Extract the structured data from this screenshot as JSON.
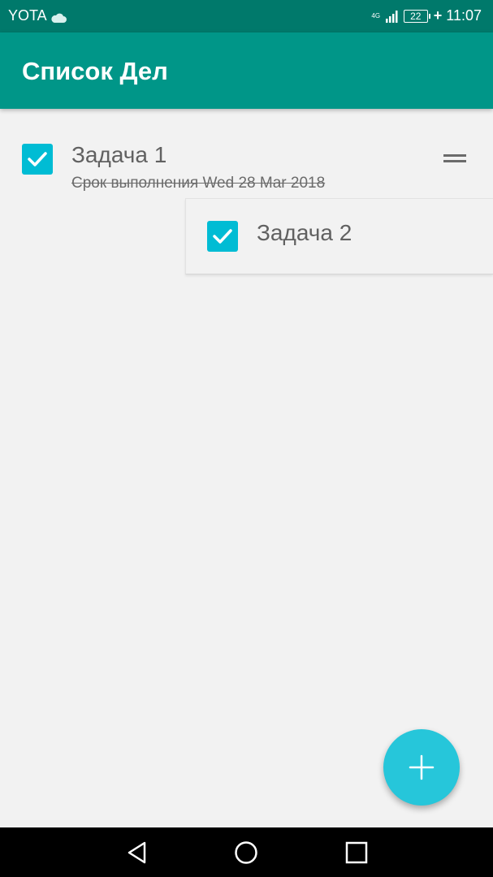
{
  "status_bar": {
    "carrier": "YOTA",
    "network_type": "4G",
    "battery_level": "22",
    "charging_symbol": "+",
    "time": "11:07"
  },
  "app_bar": {
    "title": "Список Дел"
  },
  "tasks": [
    {
      "title": "Задача 1",
      "due_label": "Срок выполнения",
      "due_date": "Wed 28 Mar 2018",
      "checked": true
    },
    {
      "title": "Задача 2",
      "checked": true
    }
  ],
  "colors": {
    "status_bar": "#00796b",
    "app_bar": "#009688",
    "checkbox": "#00bcd4",
    "fab": "#26c6da",
    "background": "#f2f2f2"
  },
  "icons": {
    "fab": "plus-icon",
    "drag": "drag-handle-icon",
    "nav": [
      "back-icon",
      "home-icon",
      "recents-icon"
    ]
  }
}
